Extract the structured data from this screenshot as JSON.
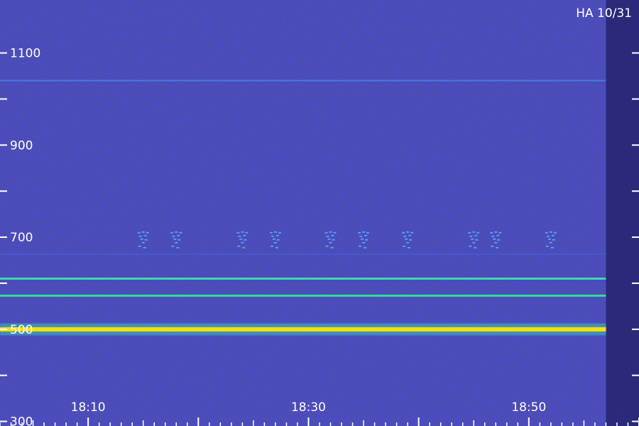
{
  "chart_data": {
    "type": "heatmap",
    "corner_label": "HA 10/31",
    "xlabel": "",
    "ylabel": "",
    "x_ticks": [
      "18:10",
      "18:30",
      "18:50"
    ],
    "y_ticks": [
      "1100",
      "900",
      "700",
      "500",
      "300"
    ],
    "x_range_minutes_of_day": [
      1082,
      1140
    ],
    "y_range": [
      290,
      1215
    ],
    "data_end_time": "18:57",
    "lines": [
      {
        "freq": 500,
        "intensity": "strong",
        "color": "#ffe000"
      },
      {
        "freq": 573,
        "intensity": "medium",
        "color": "#2ee890"
      },
      {
        "freq": 610,
        "intensity": "medium",
        "color": "#38e4b0"
      },
      {
        "freq": 1040,
        "intensity": "weak",
        "color": "#3c8cf0"
      },
      {
        "freq": 663,
        "intensity": "faint",
        "color": "#3a6de8"
      }
    ],
    "bursts": [
      {
        "time": "18:15",
        "freq": 705
      },
      {
        "time": "18:18",
        "freq": 705
      },
      {
        "time": "18:24",
        "freq": 705
      },
      {
        "time": "18:27",
        "freq": 705
      },
      {
        "time": "18:32",
        "freq": 705
      },
      {
        "time": "18:35",
        "freq": 705
      },
      {
        "time": "18:39",
        "freq": 705
      },
      {
        "time": "18:45",
        "freq": 705
      },
      {
        "time": "18:47",
        "freq": 705
      },
      {
        "time": "18:52",
        "freq": 705
      }
    ],
    "background_colors": {
      "noise_low": "#0a0a66",
      "noise_high": "#3a3aff",
      "margin": "#07073a"
    },
    "grid": false
  }
}
